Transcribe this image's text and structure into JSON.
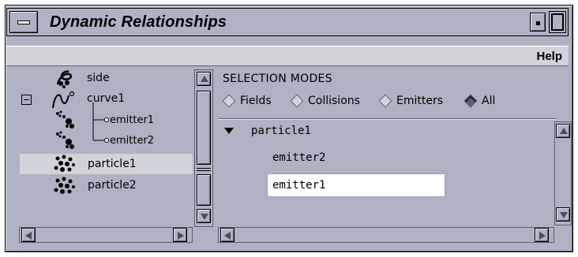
{
  "window": {
    "title": "Dynamic Relationships",
    "menu": {
      "help_label": "Help"
    }
  },
  "left_tree": {
    "items": [
      {
        "label": "side",
        "icon": "object-icon",
        "selected": false
      },
      {
        "label": "curve1",
        "icon": "curve-icon",
        "selected": false
      },
      {
        "label": "emitter1",
        "icon": "emitter-icon",
        "selected": false
      },
      {
        "label": "emitter2",
        "icon": "emitter-icon",
        "selected": false
      },
      {
        "label": "particle1",
        "icon": "particle-icon",
        "selected": true
      },
      {
        "label": "particle2",
        "icon": "particle-icon",
        "selected": false
      }
    ]
  },
  "selection_modes": {
    "title": "SELECTION MODES",
    "options": [
      {
        "label": "Fields",
        "selected": false
      },
      {
        "label": "Collisions",
        "selected": false
      },
      {
        "label": "Emitters",
        "selected": false
      },
      {
        "label": "All",
        "selected": true
      }
    ]
  },
  "right_list": {
    "parent": "particle1",
    "children": [
      "emitter2"
    ],
    "editing_value": "emitter1"
  },
  "colors": {
    "panel": "#aeb2c3",
    "menubar": "#d2d2d9",
    "selection": "#d2d2d9",
    "field": "#ffffff"
  }
}
